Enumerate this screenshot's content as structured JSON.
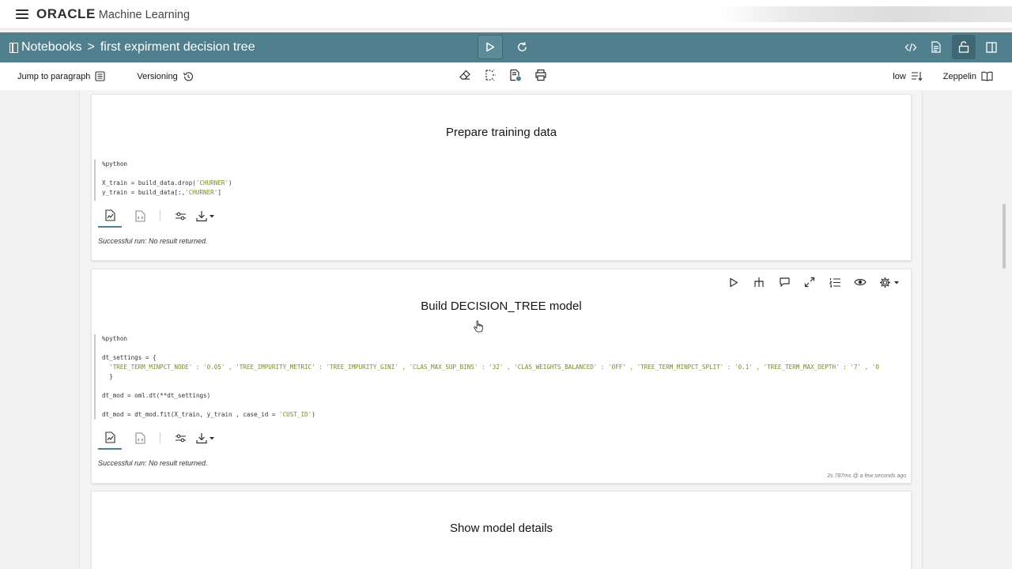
{
  "header": {
    "brand_oracle": "ORACLE",
    "brand_product": "Machine Learning"
  },
  "notebook_bar": {
    "breadcrumb_root": "Notebooks",
    "separator": ">",
    "notebook_title": "first expirment decision tree",
    "icons": [
      "run-all-icon",
      "refresh-icon",
      "code-icon",
      "document-icon",
      "unlock-icon",
      "split-panel-icon"
    ]
  },
  "toolbar": {
    "jump_label": "Jump to paragraph",
    "versioning_label": "Versioning",
    "priority_label": "low",
    "interpreter_label": "Zeppelin",
    "center_icons": [
      "eraser-icon",
      "clear-output-icon",
      "export-icon",
      "print-icon"
    ]
  },
  "paragraphs": [
    {
      "title": "Prepare training data",
      "code_lines": [
        "%python",
        "",
        "X_train = build_data.drop('CHURNER')",
        "y_train = build_data[:,'CHURNER']"
      ],
      "result": "Successful run: No result returned."
    },
    {
      "title": "Build DECISION_TREE model",
      "code_lines": [
        "%python",
        "",
        "dt_settings = {",
        "  'TREE_TERM_MINPCT_NODE' : '0.05' , 'TREE_IMPURITY_METRIC' : 'TREE_IMPURITY_GINI' , 'CLAS_MAX_SUP_BINS' : '32' , 'CLAS_WEIGHTS_BALANCED' : 'OFF' , 'TREE_TERM_MINPCT_SPLIT' : '0.1' , 'TREE_TERM_MAX_DEPTH' : '7' , 'O",
        "  }",
        "",
        "dt_mod = oml.dt(**dt_settings)",
        "",
        "dt_mod = dt_mod.fit(X_train, y_train , case_id = 'CUST_ID')"
      ],
      "result": "Successful run: No result returned.",
      "meta": "2s 787ms @ a few seconds ago"
    },
    {
      "title": "Show model details"
    }
  ]
}
